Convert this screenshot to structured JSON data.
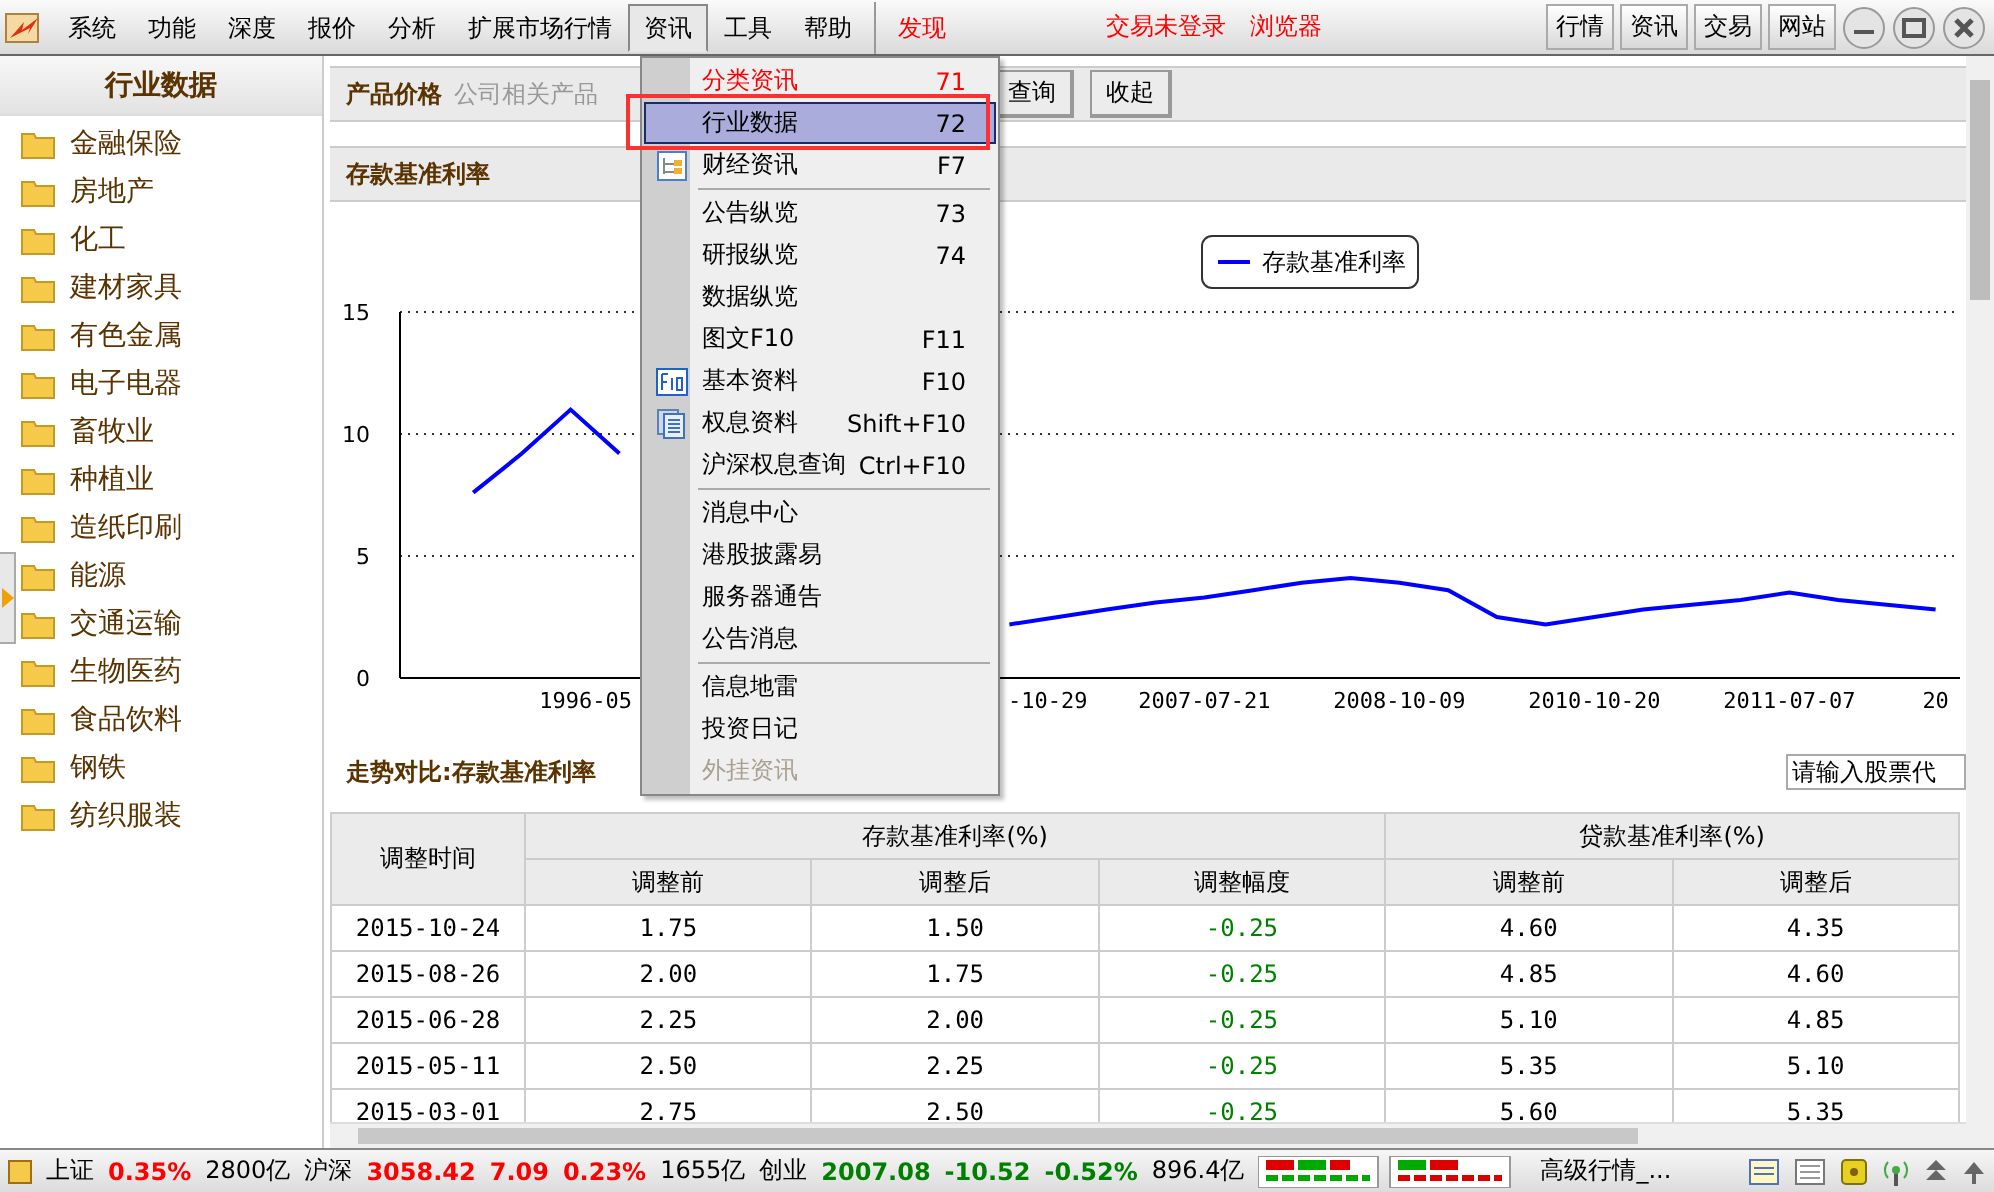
{
  "menubar": {
    "items": [
      {
        "label": "系统",
        "selected": false
      },
      {
        "label": "功能",
        "selected": false
      },
      {
        "label": "深度",
        "selected": false
      },
      {
        "label": "报价",
        "selected": false
      },
      {
        "label": "分析",
        "selected": false
      },
      {
        "label": "扩展市场行情",
        "selected": false
      },
      {
        "label": "资讯",
        "selected": true
      },
      {
        "label": "工具",
        "selected": false
      },
      {
        "label": "帮助",
        "selected": false
      }
    ],
    "discover": "发现",
    "notices": [
      "交易未登录",
      "浏览器"
    ],
    "quick_buttons": [
      "行情",
      "资讯",
      "交易",
      "网站"
    ]
  },
  "sidebar": {
    "title": "行业数据",
    "items": [
      "金融保险",
      "房地产",
      "化工",
      "建材家具",
      "有色金属",
      "电子电器",
      "畜牧业",
      "种植业",
      "造纸印刷",
      "能源",
      "交通运输",
      "生物医药",
      "食品饮料",
      "钢铁",
      "纺织服装"
    ]
  },
  "filter": {
    "title": "产品价格",
    "select": "公司相关产品",
    "buttons": [
      "查询",
      "收起"
    ]
  },
  "section_title": "存款基准利率",
  "chart_data": {
    "type": "line",
    "categories": [
      null,
      null,
      null,
      null,
      null,
      null,
      null,
      null,
      null,
      null,
      null,
      null,
      null,
      null,
      null,
      null,
      "2007-07-21",
      null,
      null,
      null,
      "2008-10-09",
      null,
      null,
      null,
      "2010-10-20",
      null,
      null,
      null,
      "2011-07-07",
      null,
      null,
      "20"
    ],
    "series": [
      {
        "name": "存款基准利率",
        "color": "#0000ff",
        "values": [
          null,
          7.6,
          9.2,
          11.0,
          9.2,
          null,
          null,
          null,
          null,
          null,
          null,
          null,
          2.2,
          2.5,
          2.8,
          3.1,
          3.3,
          3.6,
          3.9,
          4.1,
          3.9,
          3.6,
          2.5,
          2.2,
          2.5,
          2.8,
          3.0,
          3.2,
          3.5,
          3.2,
          3.0,
          2.8
        ]
      }
    ],
    "ylim": [
      0,
      15
    ],
    "yticks": [
      0,
      5,
      10,
      15
    ]
  },
  "chart_partial_labels": [
    "1996-05",
    "-10-29"
  ],
  "compare": {
    "title": "走势对比:存款基准利率",
    "placeholder": "请输入股票代"
  },
  "table": {
    "first_column": "调整时间",
    "groups": [
      {
        "title": "存款基准利率(%)",
        "columns": [
          "调整前",
          "调整后",
          "调整幅度"
        ]
      },
      {
        "title": "贷款基准利率(%)",
        "columns": [
          "调整前",
          "调整后"
        ]
      }
    ],
    "rows": [
      {
        "cells": [
          "2015-10-24",
          "1.75",
          "1.50",
          "-0.25",
          "4.60",
          "4.35"
        ],
        "rising": false
      },
      {
        "cells": [
          "2015-08-26",
          "2.00",
          "1.75",
          "-0.25",
          "4.85",
          "4.60"
        ],
        "rising": false
      },
      {
        "cells": [
          "2015-06-28",
          "2.25",
          "2.00",
          "-0.25",
          "5.10",
          "4.85"
        ],
        "rising": false
      },
      {
        "cells": [
          "2015-05-11",
          "2.50",
          "2.25",
          "-0.25",
          "5.35",
          "5.10"
        ],
        "rising": false
      },
      {
        "cells": [
          "2015-03-01",
          "2.75",
          "2.50",
          "-0.25",
          "5.60",
          "5.35"
        ],
        "rising": false
      }
    ]
  },
  "menu": {
    "groups": [
      [
        {
          "label": "分类资讯",
          "shortcut": "71",
          "color": "#ff0000",
          "selected": false,
          "disabled": false
        },
        {
          "label": "行业数据",
          "shortcut": "72",
          "selected": true,
          "disabled": false
        },
        {
          "label": "财经资讯",
          "shortcut": "F7",
          "kind": "tree",
          "selected": false,
          "disabled": false
        }
      ],
      [
        {
          "label": "公告纵览",
          "shortcut": "73",
          "selected": false,
          "disabled": false
        },
        {
          "label": "研报纵览",
          "shortcut": "74",
          "selected": false,
          "disabled": false
        },
        {
          "label": "数据纵览",
          "selected": false,
          "disabled": false
        },
        {
          "label": "图文F10",
          "shortcut": "F11",
          "selected": false,
          "disabled": false
        },
        {
          "label": "基本资料",
          "shortcut": "F10",
          "kind": "f10",
          "selected": false,
          "disabled": false
        },
        {
          "label": "权息资料",
          "shortcut": "Shift+F10",
          "kind": "pages",
          "selected": false,
          "disabled": false
        },
        {
          "label": "沪深权息查询",
          "shortcut": "Ctrl+F10",
          "selected": false,
          "disabled": false
        }
      ],
      [
        {
          "label": "消息中心",
          "selected": false,
          "disabled": false
        },
        {
          "label": "港股披露易",
          "selected": false,
          "disabled": false
        },
        {
          "label": "服务器通告",
          "selected": false,
          "disabled": false
        },
        {
          "label": "公告消息",
          "selected": false,
          "disabled": false
        }
      ],
      [
        {
          "label": "信息地雷",
          "selected": false,
          "disabled": false
        },
        {
          "label": "投资日记",
          "selected": false,
          "disabled": false
        },
        {
          "label": "外挂资讯",
          "selected": false,
          "disabled": true
        }
      ]
    ]
  },
  "status_bar": {
    "items": [
      {
        "text": "上证",
        "color": "#000000"
      },
      {
        "text": "0.35%",
        "color": "#ff0000"
      },
      {
        "text": "2800亿",
        "color": "#000000"
      },
      {
        "text": "沪深",
        "color": "#000000"
      },
      {
        "text": "3058.42",
        "color": "#ff0000"
      },
      {
        "text": "7.09",
        "color": "#ff0000"
      },
      {
        "text": "0.23%",
        "color": "#ff0000"
      },
      {
        "text": "1655亿",
        "color": "#000000"
      },
      {
        "text": "创业",
        "color": "#000000"
      },
      {
        "text": "2007.08",
        "color": "#008000"
      },
      {
        "text": "-10.52",
        "color": "#008000"
      },
      {
        "text": "-0.52%",
        "color": "#008000"
      },
      {
        "text": "896.4亿",
        "color": "#000000"
      }
    ],
    "advanced": "高级行情_..."
  }
}
